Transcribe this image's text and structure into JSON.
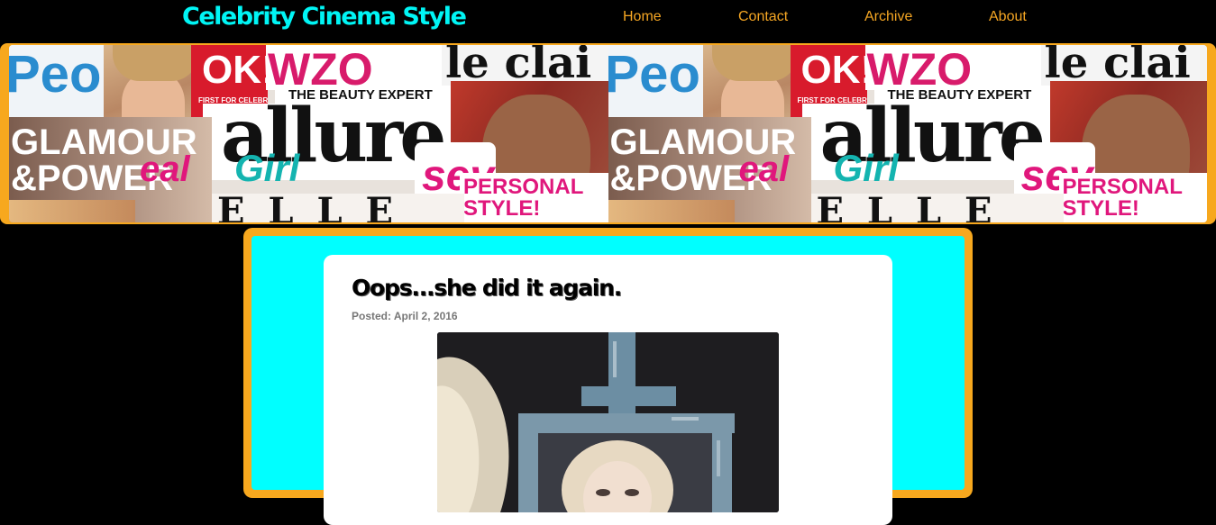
{
  "site": {
    "title": "Celebrity Cinema Style"
  },
  "nav": {
    "items": [
      {
        "label": "Home"
      },
      {
        "label": "Contact"
      },
      {
        "label": "Archive"
      },
      {
        "label": "About"
      }
    ]
  },
  "banner": {
    "magazines": {
      "people": "Peop",
      "ok": "OK!",
      "ok_tagline": "FIRST FOR CELEBRITY NEWS",
      "beauty_expert": "THE BEAUTY EXPERT",
      "marie_claire": "le clai",
      "allure": "allure",
      "glamour": "GLAMOUR",
      "power": "&POWER",
      "real_girl": "Girl",
      "real_girl_prefix": "eal",
      "seventeen": "sev",
      "personal_style": "PERSONAL",
      "personal_style_2": "STYLE!",
      "elle": "E L L E"
    }
  },
  "post": {
    "title": "Oops...she did it again.",
    "meta": "Posted: April 2, 2016"
  },
  "colors": {
    "accent_orange": "#f7a81e",
    "title_cyan": "#00f5f5",
    "content_bg": "#00ffff",
    "nav_text": "#f5a623"
  }
}
